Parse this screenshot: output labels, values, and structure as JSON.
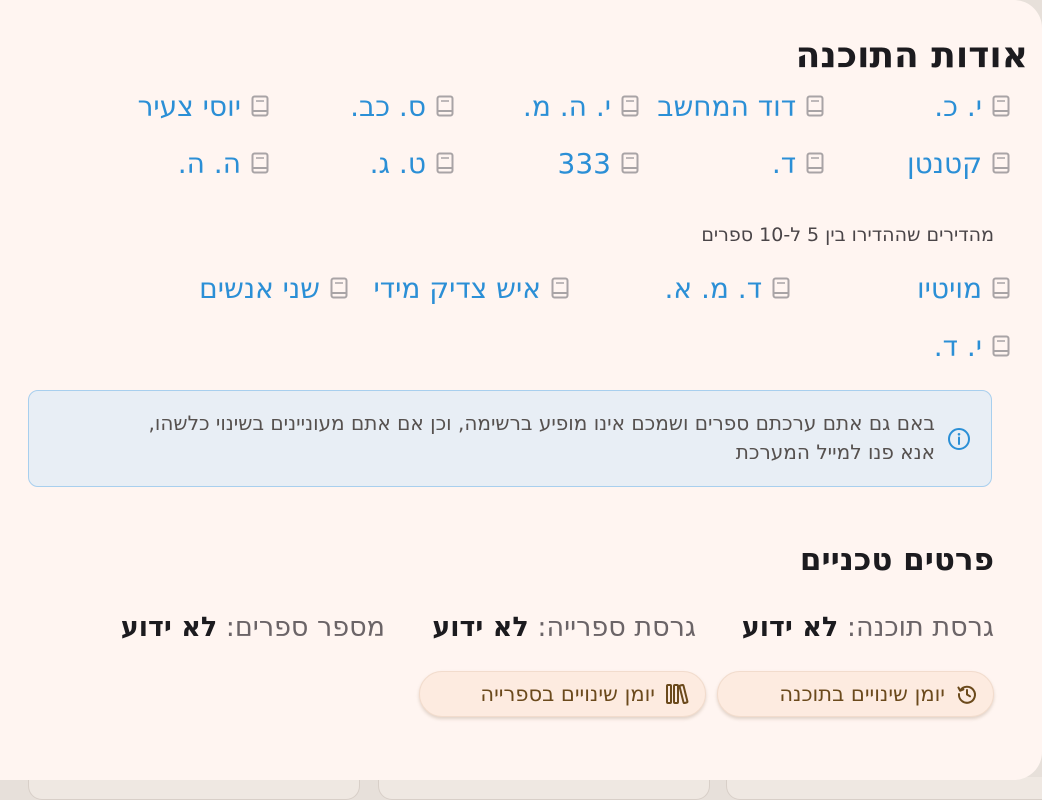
{
  "dialog": {
    "title": "אודות התוכנה"
  },
  "top_rows": {
    "row_partial": [
      {
        "label": "י. כ.",
        "icon": "book-icon"
      },
      {
        "label": "דוד המחשב",
        "icon": "book-icon"
      },
      {
        "label": "י. ה. מ.",
        "icon": "book-icon"
      },
      {
        "label": "ס. כב.",
        "icon": "book-icon"
      },
      {
        "label": "יוסי צעיר",
        "icon": "book-icon"
      }
    ],
    "row_full": [
      {
        "label": "קטנטן",
        "icon": "book-icon"
      },
      {
        "label": "ד.",
        "icon": "book-icon"
      },
      {
        "label": "333",
        "icon": "book-icon"
      },
      {
        "label": "ט. ג.",
        "icon": "book-icon"
      },
      {
        "label": "ה. ה.",
        "icon": "book-icon"
      }
    ]
  },
  "editors_5_10": {
    "heading": "מהדירים שההדירו בין 5 ל-10 ספרים",
    "row1": [
      {
        "label": "מויטיו",
        "icon": "book-icon"
      },
      {
        "label": "ד. מ. א.",
        "icon": "book-icon"
      },
      {
        "label": "איש צדיק מידי",
        "icon": "book-icon"
      },
      {
        "label": "שני אנשים",
        "icon": "book-icon"
      }
    ],
    "row2": [
      {
        "label": "י. ד.",
        "icon": "book-icon"
      }
    ]
  },
  "info": {
    "icon": "info-circle-icon",
    "text": "באם גם אתם ערכתם ספרים ושמכם אינו מופיע ברשימה, וכן אם אתם מעוניינים בשינוי כלשהו, אנא פנו למייל המערכת"
  },
  "technical": {
    "title": "פרטים טכניים",
    "software_version_label": "גרסת תוכנה:",
    "software_version_value": "לא ידוע",
    "library_version_label": "גרסת ספרייה:",
    "library_version_value": "לא ידוע",
    "books_count_label": "מספר ספרים:",
    "books_count_value": "לא ידוע"
  },
  "buttons": {
    "software_changelog": "יומן שינויים בתוכנה",
    "software_changelog_icon": "history-icon",
    "library_changelog": "יומן שינויים בספרייה",
    "library_changelog_icon": "library-books-icon"
  },
  "colors": {
    "dialog_bg": "#fff5f1",
    "link": "#2b8fd6",
    "info_bg": "#e8eef5",
    "info_border": "#a8cfee",
    "button_bg": "#fdebe0",
    "button_text": "#6b4a1c"
  }
}
